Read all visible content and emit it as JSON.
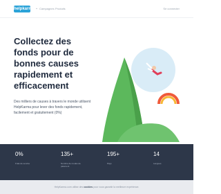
{
  "nav": {
    "logo": "helpkarma",
    "caret": "⌄",
    "links": [
      "Campagnes",
      "Produits"
    ],
    "login": "Se connecter"
  },
  "hero": {
    "title": "Collectez des fonds pour de bonnes causes rapidement et efficacement",
    "subtitle": "Des milliers de causes à travers le monde utilisent HelpKarma pour lever des fonds rapidement, facilement et gratuitement (0%)"
  },
  "stats": [
    {
      "value": "0%",
      "label": "Frais de service"
    },
    {
      "value": "135+",
      "label": "Nombre de modes de paiement"
    },
    {
      "value": "195+",
      "label": "Pays"
    },
    {
      "value": "14",
      "label": "Langues"
    }
  ],
  "footer": {
    "before": "HelpKarma.com utilise des",
    "bold": "cookies",
    "after": "pour vous garantir la meilleure expérience."
  },
  "colors": {
    "brand": "#2ba3d8",
    "dark": "#2d3749",
    "mountain": "#5cb85c"
  }
}
